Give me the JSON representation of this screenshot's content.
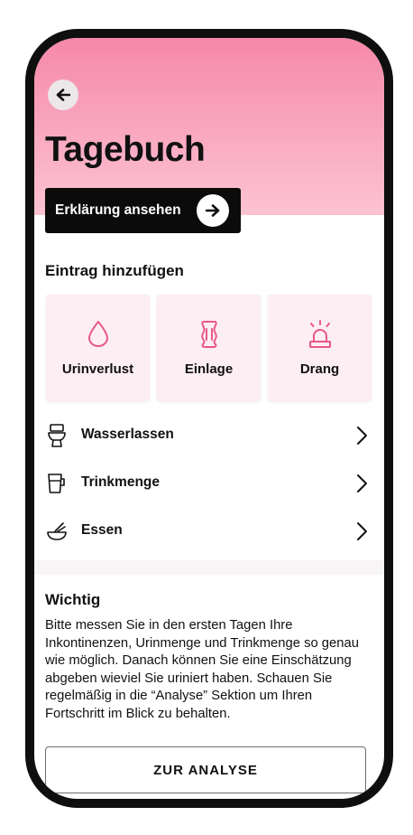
{
  "header": {
    "title": "Tagebuch",
    "explain_button_label": "Erklärung ansehen"
  },
  "add_entry": {
    "title": "Eintrag hinzufügen",
    "tiles": [
      {
        "label": "Urinverlust",
        "icon": "drop-icon"
      },
      {
        "label": "Einlage",
        "icon": "pad-icon"
      },
      {
        "label": "Drang",
        "icon": "alarm-light-icon"
      }
    ]
  },
  "list": [
    {
      "label": "Wasserlassen",
      "icon": "toilet-icon"
    },
    {
      "label": "Trinkmenge",
      "icon": "cup-icon"
    },
    {
      "label": "Essen",
      "icon": "bowl-icon"
    }
  ],
  "info": {
    "title": "Wichtig",
    "text": "Bitte messen Sie in den ersten Tagen Ihre Inkontinenzen, Urinmenge und Trinkmenge so genau wie möglich. Danach können Sie eine Einschätzung abgeben wieviel Sie uriniert haben. Schauen Sie regelmäßig in die “Analyse” Sektion um Ihren Fortschritt im Blick zu behalten."
  },
  "analysis_button_label": "ZUR ANALYSE",
  "colors": {
    "accent": "#e8578a",
    "header_top": "#f588a8",
    "header_bottom": "#fcc3d3",
    "tile_bg": "#fdeef3"
  }
}
